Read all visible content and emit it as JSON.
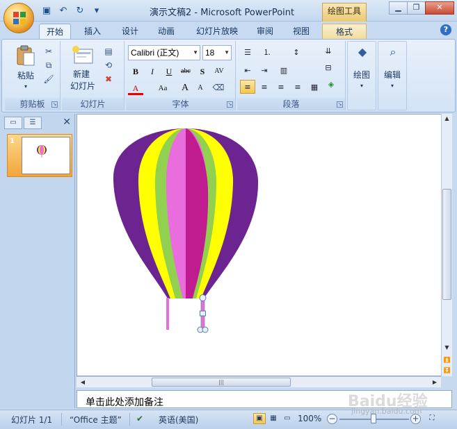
{
  "title_bar": {
    "title": "演示文稿2 - Microsoft PowerPoint",
    "context_group": "绘图工具",
    "controls": [
      "minimize",
      "restore",
      "close"
    ]
  },
  "tabs": [
    {
      "label": "开始",
      "active": true
    },
    {
      "label": "插入"
    },
    {
      "label": "设计"
    },
    {
      "label": "动画"
    },
    {
      "label": "幻灯片放映"
    },
    {
      "label": "审阅"
    },
    {
      "label": "视图"
    },
    {
      "label": "格式",
      "context": true
    }
  ],
  "ribbon": {
    "clipboard": {
      "paste": "粘贴",
      "group": "剪贴板"
    },
    "slides": {
      "new_slide_line1": "新建",
      "new_slide_line2": "幻灯片",
      "group": "幻灯片"
    },
    "font": {
      "font_name": "Calibri (正文)",
      "font_size": "18",
      "group": "字体",
      "bold": "B",
      "italic": "I",
      "underline": "U",
      "strike": "abc",
      "shadow": "S",
      "spacing": "AV",
      "font_color": "A",
      "change_case": "Aa",
      "grow": "A",
      "shrink": "A"
    },
    "paragraph": {
      "group": "段落"
    },
    "drawing": {
      "label": "绘图"
    },
    "editing": {
      "label": "编辑"
    }
  },
  "slides_pane": {
    "thumbnail_number": "1"
  },
  "notes_placeholder": "单击此处添加备注",
  "status": {
    "slide_info": "幻灯片 1/1",
    "theme": "“Office 主题”",
    "language": "英语(美国)",
    "zoom": "100%"
  },
  "balloon_colors": {
    "purple": "#6b2490",
    "yellow": "#ffff00",
    "green": "#92d050",
    "pink": "#e96ddd",
    "magenta": "#c01b8f",
    "rope": "#e370d8"
  },
  "watermark": {
    "text": "Baidu经验",
    "sub": "jingyan.baidu.com"
  }
}
